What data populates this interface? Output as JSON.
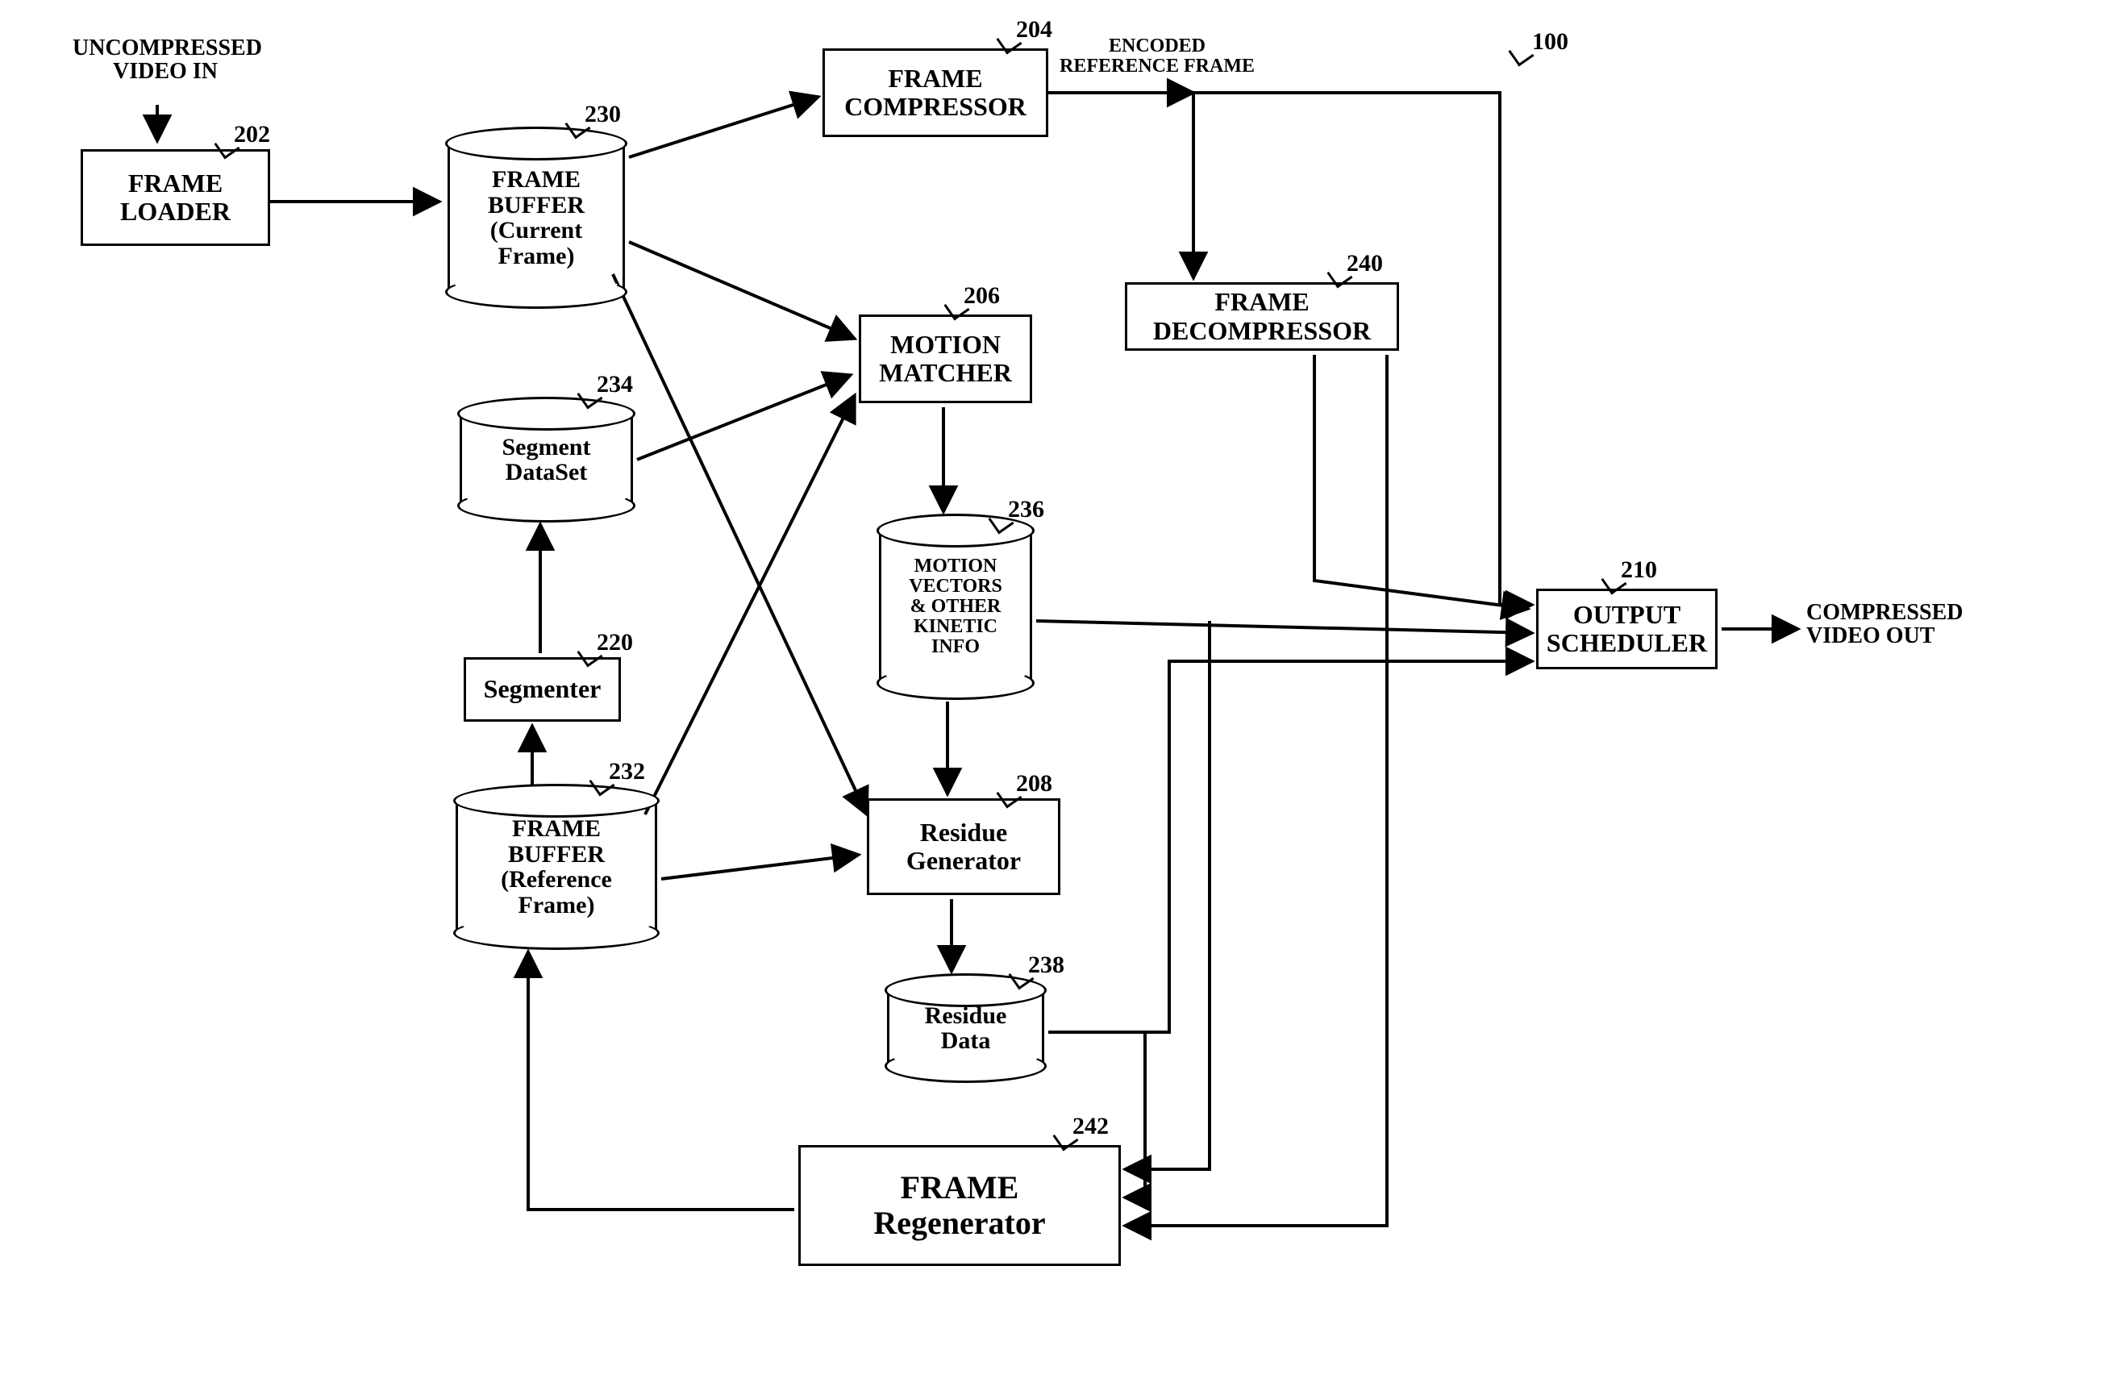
{
  "figure_ref": "100",
  "io": {
    "input": "UNCOMPRESSED\nVIDEO IN",
    "output": "COMPRESSED\nVIDEO OUT"
  },
  "edge_labels": {
    "encoded_ref_frame": "ENCODED\nREFERENCE FRAME"
  },
  "blocks": {
    "frame_loader": {
      "label": "FRAME\nLOADER",
      "ref": "202"
    },
    "frame_compressor": {
      "label": "FRAME\nCOMPRESSOR",
      "ref": "204"
    },
    "motion_matcher": {
      "label": "MOTION\nMATCHER",
      "ref": "206"
    },
    "residue_generator": {
      "label": "Residue\nGenerator",
      "ref": "208"
    },
    "output_scheduler": {
      "label": "OUTPUT\nSCHEDULER",
      "ref": "210"
    },
    "segmenter": {
      "label": "Segmenter",
      "ref": "220"
    },
    "frame_decompressor": {
      "label": "FRAME\nDECOMPRESSOR",
      "ref": "240"
    },
    "frame_regenerator": {
      "label": "FRAME\nRegenerator",
      "ref": "242"
    }
  },
  "datastores": {
    "frame_buffer_current": {
      "label": "FRAME\nBUFFER\n(Current\nFrame)",
      "ref": "230"
    },
    "frame_buffer_reference": {
      "label": "FRAME\nBUFFER\n(Reference\nFrame)",
      "ref": "232"
    },
    "segment_dataset": {
      "label": "Segment\nDataSet",
      "ref": "234"
    },
    "motion_vectors": {
      "label": "MOTION\nVECTORS\n& OTHER\nKINETIC\nINFO",
      "ref": "236"
    },
    "residue_data": {
      "label": "Residue\nData",
      "ref": "238"
    }
  }
}
